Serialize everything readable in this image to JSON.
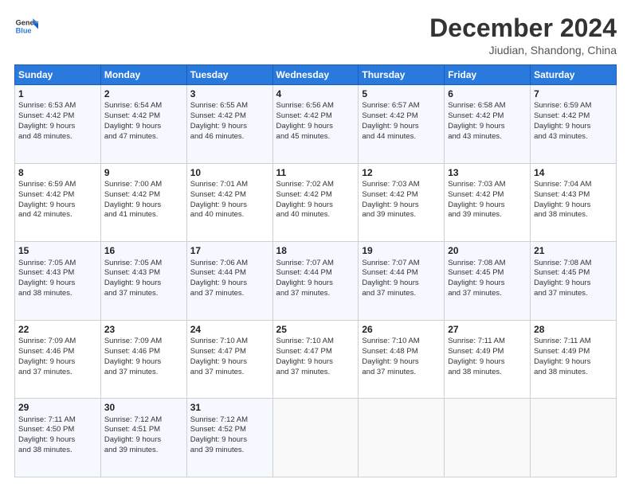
{
  "header": {
    "logo_line1": "General",
    "logo_line2": "Blue",
    "month": "December 2024",
    "location": "Jiudian, Shandong, China"
  },
  "weekdays": [
    "Sunday",
    "Monday",
    "Tuesday",
    "Wednesday",
    "Thursday",
    "Friday",
    "Saturday"
  ],
  "weeks": [
    [
      {
        "day": "1",
        "info": "Sunrise: 6:53 AM\nSunset: 4:42 PM\nDaylight: 9 hours\nand 48 minutes."
      },
      {
        "day": "2",
        "info": "Sunrise: 6:54 AM\nSunset: 4:42 PM\nDaylight: 9 hours\nand 47 minutes."
      },
      {
        "day": "3",
        "info": "Sunrise: 6:55 AM\nSunset: 4:42 PM\nDaylight: 9 hours\nand 46 minutes."
      },
      {
        "day": "4",
        "info": "Sunrise: 6:56 AM\nSunset: 4:42 PM\nDaylight: 9 hours\nand 45 minutes."
      },
      {
        "day": "5",
        "info": "Sunrise: 6:57 AM\nSunset: 4:42 PM\nDaylight: 9 hours\nand 44 minutes."
      },
      {
        "day": "6",
        "info": "Sunrise: 6:58 AM\nSunset: 4:42 PM\nDaylight: 9 hours\nand 43 minutes."
      },
      {
        "day": "7",
        "info": "Sunrise: 6:59 AM\nSunset: 4:42 PM\nDaylight: 9 hours\nand 43 minutes."
      }
    ],
    [
      {
        "day": "8",
        "info": "Sunrise: 6:59 AM\nSunset: 4:42 PM\nDaylight: 9 hours\nand 42 minutes."
      },
      {
        "day": "9",
        "info": "Sunrise: 7:00 AM\nSunset: 4:42 PM\nDaylight: 9 hours\nand 41 minutes."
      },
      {
        "day": "10",
        "info": "Sunrise: 7:01 AM\nSunset: 4:42 PM\nDaylight: 9 hours\nand 40 minutes."
      },
      {
        "day": "11",
        "info": "Sunrise: 7:02 AM\nSunset: 4:42 PM\nDaylight: 9 hours\nand 40 minutes."
      },
      {
        "day": "12",
        "info": "Sunrise: 7:03 AM\nSunset: 4:42 PM\nDaylight: 9 hours\nand 39 minutes."
      },
      {
        "day": "13",
        "info": "Sunrise: 7:03 AM\nSunset: 4:42 PM\nDaylight: 9 hours\nand 39 minutes."
      },
      {
        "day": "14",
        "info": "Sunrise: 7:04 AM\nSunset: 4:43 PM\nDaylight: 9 hours\nand 38 minutes."
      }
    ],
    [
      {
        "day": "15",
        "info": "Sunrise: 7:05 AM\nSunset: 4:43 PM\nDaylight: 9 hours\nand 38 minutes."
      },
      {
        "day": "16",
        "info": "Sunrise: 7:05 AM\nSunset: 4:43 PM\nDaylight: 9 hours\nand 37 minutes."
      },
      {
        "day": "17",
        "info": "Sunrise: 7:06 AM\nSunset: 4:44 PM\nDaylight: 9 hours\nand 37 minutes."
      },
      {
        "day": "18",
        "info": "Sunrise: 7:07 AM\nSunset: 4:44 PM\nDaylight: 9 hours\nand 37 minutes."
      },
      {
        "day": "19",
        "info": "Sunrise: 7:07 AM\nSunset: 4:44 PM\nDaylight: 9 hours\nand 37 minutes."
      },
      {
        "day": "20",
        "info": "Sunrise: 7:08 AM\nSunset: 4:45 PM\nDaylight: 9 hours\nand 37 minutes."
      },
      {
        "day": "21",
        "info": "Sunrise: 7:08 AM\nSunset: 4:45 PM\nDaylight: 9 hours\nand 37 minutes."
      }
    ],
    [
      {
        "day": "22",
        "info": "Sunrise: 7:09 AM\nSunset: 4:46 PM\nDaylight: 9 hours\nand 37 minutes."
      },
      {
        "day": "23",
        "info": "Sunrise: 7:09 AM\nSunset: 4:46 PM\nDaylight: 9 hours\nand 37 minutes."
      },
      {
        "day": "24",
        "info": "Sunrise: 7:10 AM\nSunset: 4:47 PM\nDaylight: 9 hours\nand 37 minutes."
      },
      {
        "day": "25",
        "info": "Sunrise: 7:10 AM\nSunset: 4:47 PM\nDaylight: 9 hours\nand 37 minutes."
      },
      {
        "day": "26",
        "info": "Sunrise: 7:10 AM\nSunset: 4:48 PM\nDaylight: 9 hours\nand 37 minutes."
      },
      {
        "day": "27",
        "info": "Sunrise: 7:11 AM\nSunset: 4:49 PM\nDaylight: 9 hours\nand 38 minutes."
      },
      {
        "day": "28",
        "info": "Sunrise: 7:11 AM\nSunset: 4:49 PM\nDaylight: 9 hours\nand 38 minutes."
      }
    ],
    [
      {
        "day": "29",
        "info": "Sunrise: 7:11 AM\nSunset: 4:50 PM\nDaylight: 9 hours\nand 38 minutes."
      },
      {
        "day": "30",
        "info": "Sunrise: 7:12 AM\nSunset: 4:51 PM\nDaylight: 9 hours\nand 39 minutes."
      },
      {
        "day": "31",
        "info": "Sunrise: 7:12 AM\nSunset: 4:52 PM\nDaylight: 9 hours\nand 39 minutes."
      },
      {
        "day": "",
        "info": ""
      },
      {
        "day": "",
        "info": ""
      },
      {
        "day": "",
        "info": ""
      },
      {
        "day": "",
        "info": ""
      }
    ]
  ]
}
